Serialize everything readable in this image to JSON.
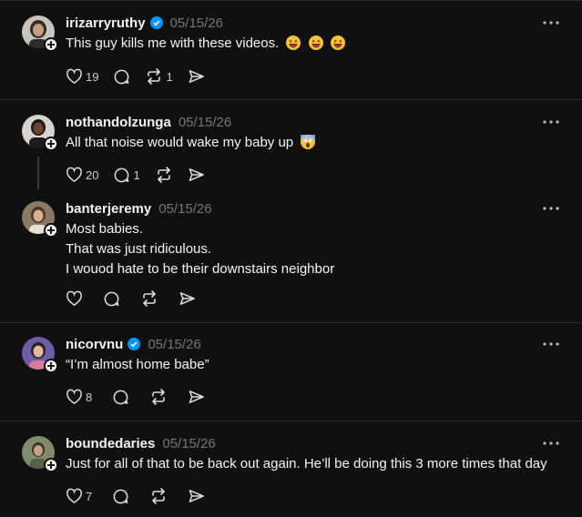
{
  "posts": [
    {
      "username": "irizarryruthy",
      "verified": true,
      "date": "05/15/26",
      "text_lines": [
        "This guy kills me with these videos."
      ],
      "emojis": [
        "grinning-squinting-face",
        "grinning-squinting-face",
        "grinning-squinting-face"
      ],
      "likes": "19",
      "replies": "",
      "reposts": "1"
    },
    {
      "username": "nothandolzunga",
      "verified": false,
      "date": "05/15/26",
      "text_lines": [
        "All that noise would wake my baby up"
      ],
      "emojis": [
        "face-screaming-in-fear"
      ],
      "likes": "20",
      "replies": "1",
      "reposts": ""
    },
    {
      "username": "banterjeremy",
      "verified": false,
      "date": "05/15/26",
      "text_lines": [
        "Most babies.",
        "That was just ridiculous.",
        "I wouod hate to be their downstairs neighbor"
      ],
      "emojis": [],
      "likes": "",
      "replies": "",
      "reposts": ""
    },
    {
      "username": "nicorvnu",
      "verified": true,
      "date": "05/15/26",
      "text_lines": [
        "“I’m almost home babe”"
      ],
      "emojis": [],
      "likes": "8",
      "replies": "",
      "reposts": ""
    },
    {
      "username": "boundedaries",
      "verified": false,
      "date": "05/15/26",
      "text_lines": [
        "Just for all of that to be back out again. He’ll be doing this 3 more times that day"
      ],
      "emojis": [],
      "likes": "7",
      "replies": "",
      "reposts": ""
    }
  ],
  "colors": {
    "background": "#101010",
    "verified_badge": "#0095f6",
    "muted_text": "#777777",
    "divider": "#2a2a2a"
  },
  "icons": [
    "heart-icon",
    "comment-icon",
    "repost-icon",
    "share-icon",
    "more-icon",
    "follow-plus-icon",
    "verified-badge-icon"
  ]
}
